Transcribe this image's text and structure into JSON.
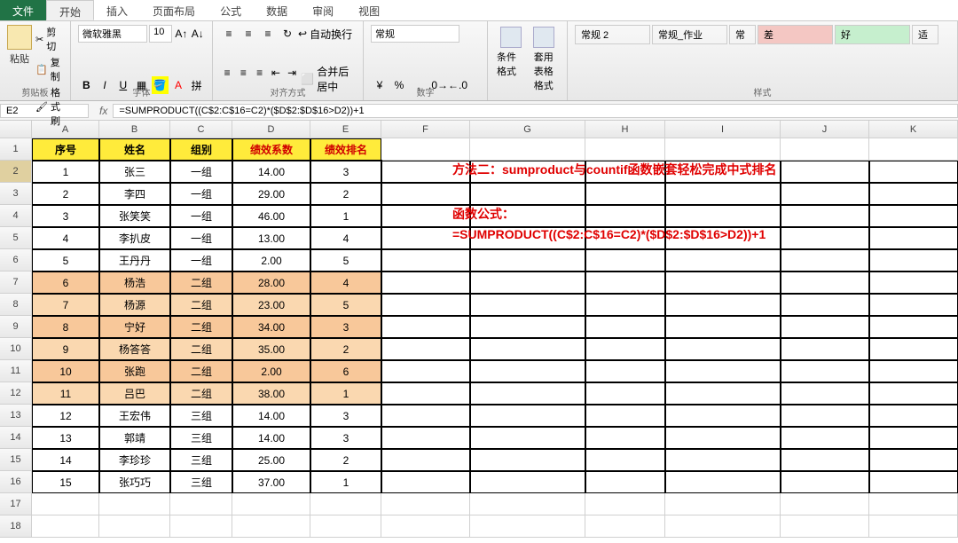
{
  "tabs": [
    "文件",
    "开始",
    "插入",
    "页面布局",
    "公式",
    "数据",
    "审阅",
    "视图"
  ],
  "clipboard": {
    "paste": "粘贴",
    "cut": "剪切",
    "copy": "复制",
    "painter": "格式刷",
    "label": "剪贴板"
  },
  "font": {
    "name": "微软雅黑",
    "size": "10",
    "label": "字体"
  },
  "align": {
    "wrap": "自动换行",
    "merge": "合并后居中",
    "label": "对齐方式"
  },
  "number": {
    "fmt": "常规",
    "label": "数字"
  },
  "styles": {
    "cond": "条件格式",
    "tbl": "套用\n表格格式",
    "label": "样式"
  },
  "cellstyles": {
    "a": "常规 2",
    "b": "常规_作业",
    "c": "常",
    "d": "差",
    "e": "好",
    "f": "适"
  },
  "namebox": "E2",
  "formula": "=SUMPRODUCT((C$2:C$16=C2)*($D$2:$D$16>D2))+1",
  "cols": [
    "A",
    "B",
    "C",
    "D",
    "E",
    "F",
    "G",
    "H",
    "I",
    "J",
    "K"
  ],
  "headers": {
    "A": "序号",
    "B": "姓名",
    "C": "组别",
    "D": "绩效系数",
    "E": "绩效排名"
  },
  "data": [
    {
      "n": "1",
      "name": "张三",
      "grp": "一组",
      "sc": "14.00",
      "rk": "3",
      "cls": ""
    },
    {
      "n": "2",
      "name": "李四",
      "grp": "一组",
      "sc": "29.00",
      "rk": "2",
      "cls": ""
    },
    {
      "n": "3",
      "name": "张笑笑",
      "grp": "一组",
      "sc": "46.00",
      "rk": "1",
      "cls": ""
    },
    {
      "n": "4",
      "name": "李扒皮",
      "grp": "一组",
      "sc": "13.00",
      "rk": "4",
      "cls": ""
    },
    {
      "n": "5",
      "name": "王丹丹",
      "grp": "一组",
      "sc": "2.00",
      "rk": "5",
      "cls": ""
    },
    {
      "n": "6",
      "name": "杨浩",
      "grp": "二组",
      "sc": "28.00",
      "rk": "4",
      "cls": "orange"
    },
    {
      "n": "7",
      "name": "杨源",
      "grp": "二组",
      "sc": "23.00",
      "rk": "5",
      "cls": "orange r2"
    },
    {
      "n": "8",
      "name": "宁好",
      "grp": "二组",
      "sc": "34.00",
      "rk": "3",
      "cls": "orange"
    },
    {
      "n": "9",
      "name": "杨答答",
      "grp": "二组",
      "sc": "35.00",
      "rk": "2",
      "cls": "orange r2"
    },
    {
      "n": "10",
      "name": "张跑",
      "grp": "二组",
      "sc": "2.00",
      "rk": "6",
      "cls": "orange"
    },
    {
      "n": "11",
      "name": "吕巴",
      "grp": "二组",
      "sc": "38.00",
      "rk": "1",
      "cls": "orange r2"
    },
    {
      "n": "12",
      "name": "王宏伟",
      "grp": "三组",
      "sc": "14.00",
      "rk": "3",
      "cls": ""
    },
    {
      "n": "13",
      "name": "郭靖",
      "grp": "三组",
      "sc": "14.00",
      "rk": "3",
      "cls": ""
    },
    {
      "n": "14",
      "name": "李珍珍",
      "grp": "三组",
      "sc": "25.00",
      "rk": "2",
      "cls": ""
    },
    {
      "n": "15",
      "name": "张巧巧",
      "grp": "三组",
      "sc": "37.00",
      "rk": "1",
      "cls": ""
    }
  ],
  "annot": {
    "title": "方法二：sumproduct与countif函数嵌套轻松完成中式排名",
    "label": "函数公式：",
    "formula": "=SUMPRODUCT((C$2:C$16=C2)*($D$2:$D$16>D2))+1"
  }
}
